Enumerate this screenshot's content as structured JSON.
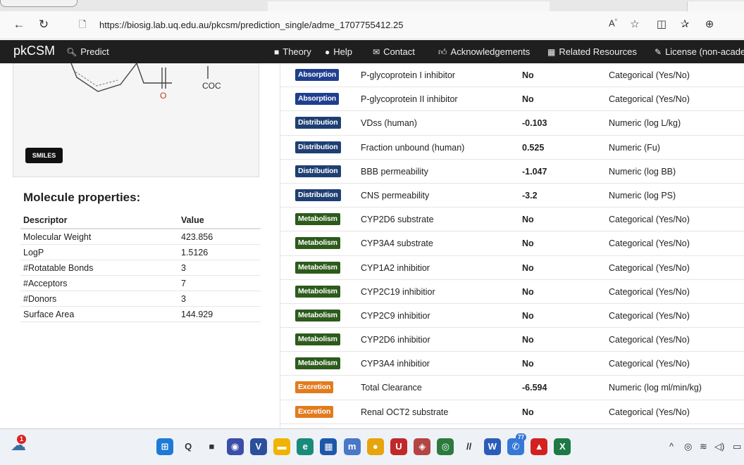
{
  "browser": {
    "url": "https://biosig.lab.uq.edu.au/pkcsm/prediction_single/adme_1707755412.25"
  },
  "site_nav": {
    "brand": "pkCSM",
    "predict": "Predict",
    "theory": "Theory",
    "help": "Help",
    "contact": "Contact",
    "acknowledgements": "Acknowledgements",
    "related_resources": "Related Resources",
    "license": "License (non-acader"
  },
  "molecule": {
    "structure_label": "COC",
    "oxygen_label": "O",
    "smiles_button": "SMILES"
  },
  "properties": {
    "title": "Molecule properties:",
    "headers": [
      "Descriptor",
      "Value"
    ],
    "rows": [
      [
        "Molecular Weight",
        "423.856"
      ],
      [
        "LogP",
        "1.5126"
      ],
      [
        "#Rotatable Bonds",
        "3"
      ],
      [
        "#Acceptors",
        "7"
      ],
      [
        "#Donors",
        "3"
      ],
      [
        "Surface Area",
        "144.929"
      ]
    ]
  },
  "category_colors": {
    "Absorption": "#1f3f8f",
    "Distribution": "#1f3f73",
    "Metabolism": "#2c5b1b",
    "Excretion": "#e27b1f"
  },
  "predictions": [
    {
      "category": "Absorption",
      "name": "P-glycoprotein I inhibitor",
      "value": "No",
      "unit": "Categorical (Yes/No)"
    },
    {
      "category": "Absorption",
      "name": "P-glycoprotein II inhibitor",
      "value": "No",
      "unit": "Categorical (Yes/No)"
    },
    {
      "category": "Distribution",
      "name": "VDss (human)",
      "value": "-0.103",
      "unit": "Numeric (log L/kg)"
    },
    {
      "category": "Distribution",
      "name": "Fraction unbound (human)",
      "value": "0.525",
      "unit": "Numeric (Fu)"
    },
    {
      "category": "Distribution",
      "name": "BBB permeability",
      "value": "-1.047",
      "unit": "Numeric (log BB)"
    },
    {
      "category": "Distribution",
      "name": "CNS permeability",
      "value": "-3.2",
      "unit": "Numeric (log PS)"
    },
    {
      "category": "Metabolism",
      "name": "CYP2D6 substrate",
      "value": "No",
      "unit": "Categorical (Yes/No)"
    },
    {
      "category": "Metabolism",
      "name": "CYP3A4 substrate",
      "value": "No",
      "unit": "Categorical (Yes/No)"
    },
    {
      "category": "Metabolism",
      "name": "CYP1A2 inhibitior",
      "value": "No",
      "unit": "Categorical (Yes/No)"
    },
    {
      "category": "Metabolism",
      "name": "CYP2C19 inhibitior",
      "value": "No",
      "unit": "Categorical (Yes/No)"
    },
    {
      "category": "Metabolism",
      "name": "CYP2C9 inhibitior",
      "value": "No",
      "unit": "Categorical (Yes/No)"
    },
    {
      "category": "Metabolism",
      "name": "CYP2D6 inhibitior",
      "value": "No",
      "unit": "Categorical (Yes/No)"
    },
    {
      "category": "Metabolism",
      "name": "CYP3A4 inhibitior",
      "value": "No",
      "unit": "Categorical (Yes/No)"
    },
    {
      "category": "Excretion",
      "name": "Total Clearance",
      "value": "-6.594",
      "unit": "Numeric (log ml/min/kg)"
    },
    {
      "category": "Excretion",
      "name": "Renal OCT2 substrate",
      "value": "No",
      "unit": "Categorical (Yes/No)"
    }
  ],
  "taskbar": {
    "notification_count": "1",
    "whatsapp_count": "77",
    "icons": [
      {
        "name": "start-icon",
        "glyph": "⊞",
        "color": "#1f7ad6"
      },
      {
        "name": "search-icon",
        "glyph": "Q",
        "color": "#333"
      },
      {
        "name": "task-view-icon",
        "glyph": "■",
        "color": "#333"
      },
      {
        "name": "chat-icon",
        "glyph": "◉",
        "color": "#3b4ea8"
      },
      {
        "name": "app-icon",
        "glyph": "V",
        "color": "#2b4f9c"
      },
      {
        "name": "file-explorer-icon",
        "glyph": "▬",
        "color": "#f0b400"
      },
      {
        "name": "edge-browser-icon",
        "glyph": "e",
        "color": "#1a8b7a"
      },
      {
        "name": "calendar-icon",
        "glyph": "▦",
        "color": "#1d58a8"
      },
      {
        "name": "mypharma-icon",
        "glyph": "m",
        "color": "#4a78c7"
      },
      {
        "name": "chrome-icon",
        "glyph": "●",
        "color": "#e8a40c"
      },
      {
        "name": "shield-app-icon",
        "glyph": "U",
        "color": "#c0282a"
      },
      {
        "name": "media-icon",
        "glyph": "◈",
        "color": "#b34545"
      },
      {
        "name": "vpn-icon",
        "glyph": "◎",
        "color": "#2c7a3d"
      },
      {
        "name": "slash-app-icon",
        "glyph": "//",
        "color": "#222"
      },
      {
        "name": "word-icon",
        "glyph": "W",
        "color": "#2b5cb8"
      },
      {
        "name": "whatsapp-icon",
        "glyph": "✆",
        "color": "#3778d6"
      },
      {
        "name": "bank-icon",
        "glyph": "▲",
        "color": "#d42020"
      },
      {
        "name": "excel-icon",
        "glyph": "X",
        "color": "#1d7a44"
      }
    ]
  }
}
